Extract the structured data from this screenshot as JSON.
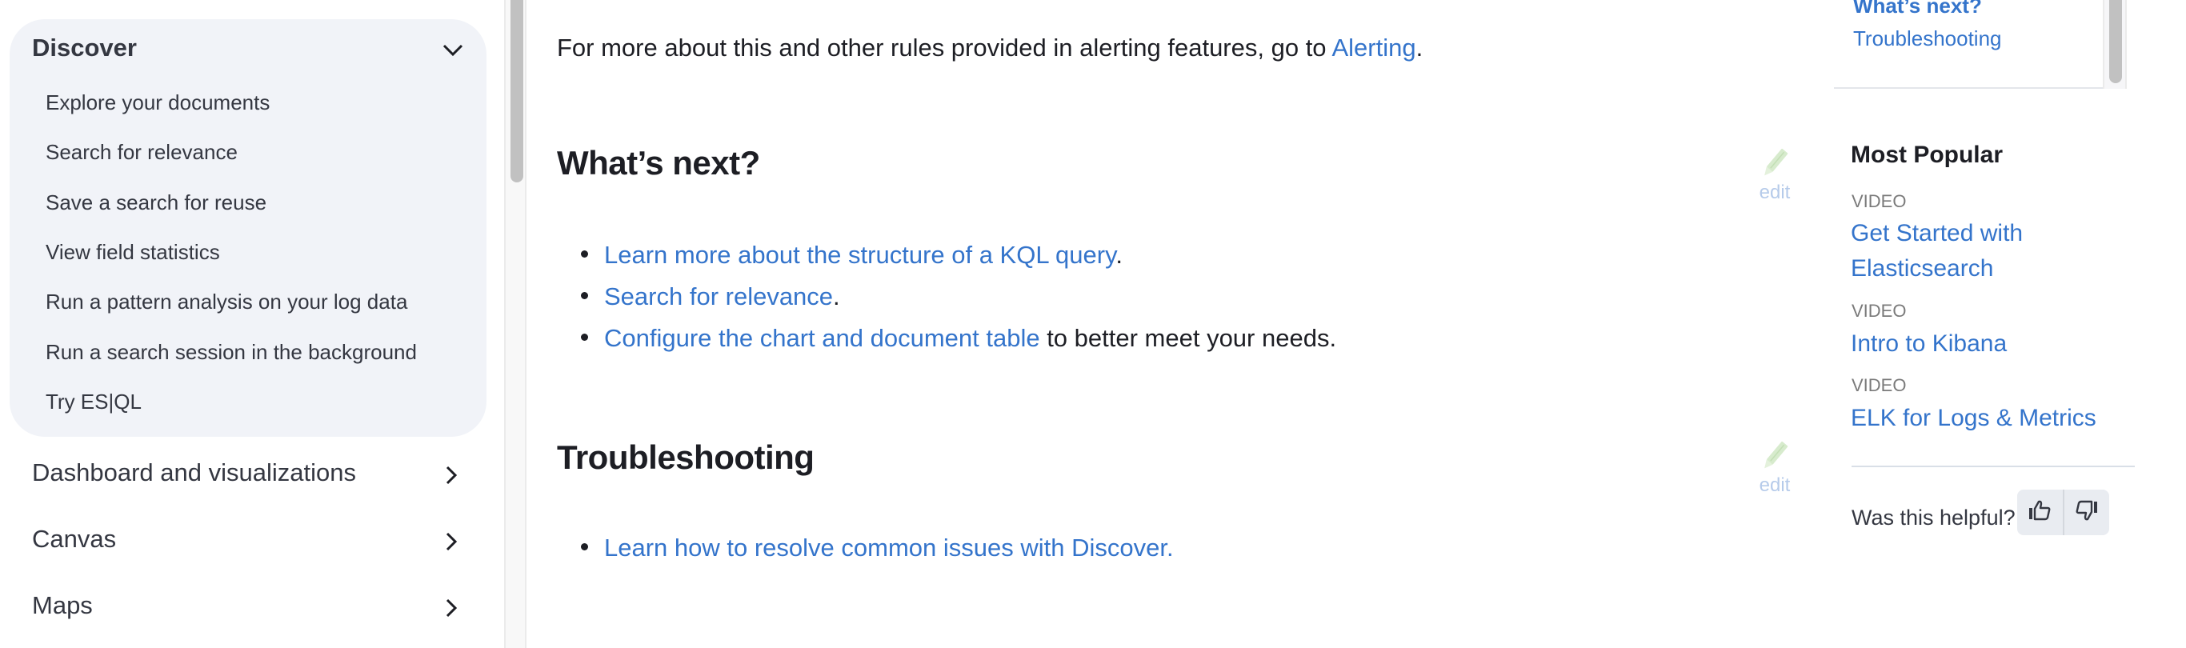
{
  "sidebar": {
    "discover": {
      "title": "Discover",
      "expanded": true,
      "items": [
        {
          "label": "Explore your documents"
        },
        {
          "label": "Search for relevance"
        },
        {
          "label": "Save a search for reuse"
        },
        {
          "label": "View field statistics"
        },
        {
          "label": "Run a pattern analysis on your log data"
        },
        {
          "label": "Run a search session in the background"
        },
        {
          "label": "Try ES|QL"
        }
      ]
    },
    "sections": [
      {
        "label": "Dashboard and visualizations",
        "icon": "chevron-right-icon"
      },
      {
        "label": "Canvas",
        "icon": "chevron-right-icon"
      },
      {
        "label": "Maps",
        "icon": "chevron-right-icon"
      }
    ]
  },
  "main": {
    "intro": {
      "text_before": "For more about this and other rules provided in alerting features, go to ",
      "link": "Alerting",
      "text_after": "."
    },
    "whats_next": {
      "heading": "What’s next?",
      "edit_label": "edit",
      "items": [
        {
          "link": "Learn more about the structure of a KQL query",
          "suffix": "."
        },
        {
          "link": "Search for relevance",
          "suffix": "."
        },
        {
          "link": "Configure the chart and document table",
          "suffix": " to better meet your needs."
        }
      ]
    },
    "troubleshooting": {
      "heading": "Troubleshooting",
      "edit_label": "edit",
      "items": [
        {
          "link": "Learn how to resolve common issues with Discover.",
          "suffix": ""
        }
      ]
    }
  },
  "right": {
    "toc": {
      "active": "What’s next?",
      "items": [
        "Troubleshooting"
      ]
    },
    "most_popular": {
      "title": "Most Popular",
      "entries": [
        {
          "type": "VIDEO",
          "title_line1": "Get Started with",
          "title_line2": "Elasticsearch"
        },
        {
          "type": "VIDEO",
          "title_line1": "Intro to Kibana"
        },
        {
          "type": "VIDEO",
          "title_line1": "ELK for Logs & Metrics"
        }
      ]
    },
    "feedback": {
      "label": "Was this helpful?",
      "thumbs_up": "thumbs-up-icon",
      "thumbs_down": "thumbs-down-icon"
    }
  },
  "colors": {
    "link": "#3474cb",
    "text": "#1d1e24",
    "sidebar_card": "#f1f3f8",
    "edit_pencil": "#cfe6c4",
    "edit_text": "#b6cbea"
  }
}
